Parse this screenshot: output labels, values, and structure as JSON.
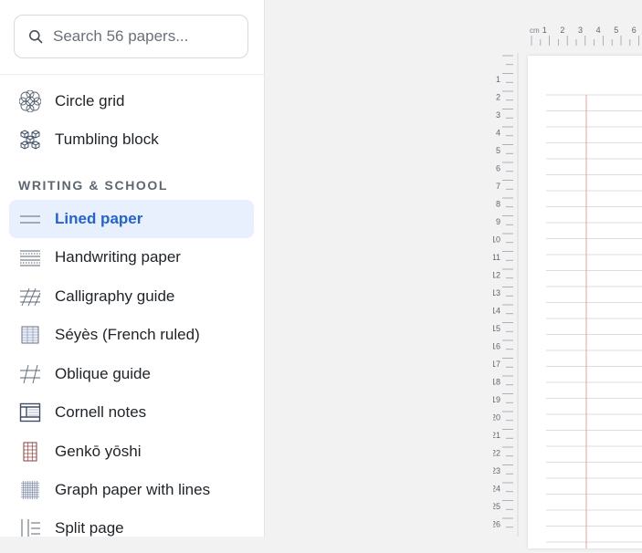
{
  "search": {
    "placeholder": "Search 56 papers..."
  },
  "sidebar": {
    "items_top": [
      {
        "label": "Circle grid",
        "icon": "circle-grid-icon"
      },
      {
        "label": "Tumbling block",
        "icon": "tumbling-block-icon"
      }
    ],
    "section_title": "WRITING & SCHOOL",
    "items": [
      {
        "label": "Lined paper",
        "icon": "lined-paper-icon",
        "active": true
      },
      {
        "label": "Handwriting paper",
        "icon": "handwriting-paper-icon"
      },
      {
        "label": "Calligraphy guide",
        "icon": "calligraphy-guide-icon"
      },
      {
        "label": "Séyès (French ruled)",
        "icon": "seyes-icon"
      },
      {
        "label": "Oblique guide",
        "icon": "oblique-guide-icon"
      },
      {
        "label": "Cornell notes",
        "icon": "cornell-notes-icon"
      },
      {
        "label": "Genkō yōshi",
        "icon": "genko-yoshi-icon"
      },
      {
        "label": "Graph paper with lines",
        "icon": "graph-lined-icon"
      },
      {
        "label": "Split page",
        "icon": "split-page-icon"
      }
    ]
  },
  "ruler_top": {
    "unit": "cm",
    "labels": [
      "1",
      "2",
      "3",
      "4",
      "5",
      "6"
    ]
  },
  "ruler_left": {
    "labels": [
      "1",
      "2",
      "3",
      "4",
      "5",
      "6",
      "7",
      "8",
      "9",
      "10",
      "11",
      "12",
      "13",
      "14",
      "15",
      "16",
      "17",
      "18",
      "19",
      "20",
      "21",
      "22",
      "23",
      "24",
      "25",
      "26"
    ]
  },
  "colors": {
    "accent": "#2563c7",
    "active_bg": "#e8f0fd",
    "margin_line": "#e0a49a",
    "rule_line": "#dcdde2"
  }
}
